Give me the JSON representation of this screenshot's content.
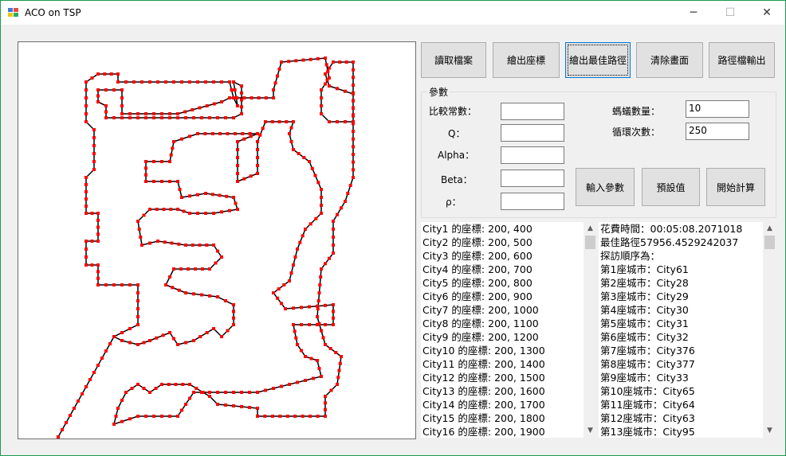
{
  "window": {
    "title": "ACO on TSP",
    "minimize": "─",
    "maximize": "☐",
    "close": "✕"
  },
  "toolbar": {
    "read_file": "讀取檔案",
    "draw_coords": "繪出座標",
    "draw_best_path": "繪出最佳路徑",
    "clear_canvas": "清除畫面",
    "export_path": "路徑檔輸出"
  },
  "params": {
    "group_title": "參數",
    "compare_label": "比較常數：",
    "q_label": "Q：",
    "alpha_label": "Alpha：",
    "beta_label": "Beta：",
    "rho_label": "ρ：",
    "compare_value": "",
    "q_value": "",
    "alpha_value": "",
    "beta_value": "",
    "rho_value": "",
    "ant_count_label": "螞蟻數量：",
    "ant_count_value": "10",
    "loop_count_label": "循環次數：",
    "loop_count_value": "250",
    "input_button": "輸入參數",
    "default_button": "預設值",
    "start_button": "開始計算"
  },
  "coord_list": [
    "City1 的座標: 200, 400",
    "City2 的座標: 200, 500",
    "City3 的座標: 200, 600",
    "City4 的座標: 200, 700",
    "City5 的座標: 200, 800",
    "City6 的座標: 200, 900",
    "City7 的座標: 200, 1000",
    "City8 的座標: 200, 1100",
    "City9 的座標: 200, 1200",
    "City10 的座標: 200, 1300",
    "City11 的座標: 200, 1400",
    "City12 的座標: 200, 1500",
    "City13 的座標: 200, 1600",
    "City14 的座標: 200, 1700",
    "City15 的座標: 200, 1800",
    "City16 的座標: 200, 1900"
  ],
  "result_list": [
    "花費時間：00:05:08.2071018",
    "最佳路徑57956.4529242037",
    "探訪順序為：",
    "第1座城市：City61",
    "第2座城市：City28",
    "第3座城市：City29",
    "第4座城市：City30",
    "第5座城市：City31",
    "第6座城市：City32",
    "第7座城市：City376",
    "第8座城市：City377",
    "第9座城市：City33",
    "第10座城市：City65",
    "第11座城市：City64",
    "第12座城市：City63",
    "第13座城市：City95"
  ],
  "scroll": {
    "up": "▲",
    "down": "▼"
  },
  "colors": {
    "city": "#ff0000",
    "path": "#000000"
  }
}
